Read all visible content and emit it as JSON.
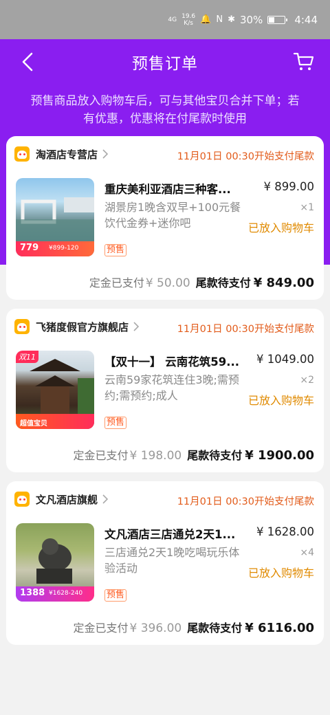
{
  "status_bar": {
    "signal": "4G",
    "speed_value": "19.6",
    "speed_unit": "K/s",
    "battery": "30%",
    "time": "4:44"
  },
  "header": {
    "title": "预售订单"
  },
  "notice": "预售商品放入购物车后，可与其他宝贝合并下单；若有优惠，优惠将在付尾款时使用",
  "orders": [
    {
      "shop_name": "淘酒店专营店",
      "deadline": "11月01日 00:30开始支付尾款",
      "title": "重庆美利亚酒店三种客...",
      "price": "¥ 899.00",
      "desc": "湖景房1晚含双早+100元餐饮代金券+迷你吧",
      "qty": "×1",
      "cart_status": "已放入购物车",
      "presale": "预售",
      "deposit_label": "定金已支付",
      "deposit_amount": "¥ 50.00",
      "balance_label": "尾款待支付",
      "balance_amount": "¥ 849.00",
      "thumb_big": "779",
      "thumb_tag": "¥899-120"
    },
    {
      "shop_name": "飞猪度假官方旗舰店",
      "deadline": "11月01日 00:30开始支付尾款",
      "title": "【双十一】 云南花筑59...",
      "price": "¥ 1049.00",
      "desc": "云南59家花筑连住3晚;需预约;需预约;成人",
      "qty": "×2",
      "cart_status": "已放入购物车",
      "presale": "预售",
      "deposit_label": "定金已支付",
      "deposit_amount": "¥ 198.00",
      "balance_label": "尾款待支付",
      "balance_amount": "¥ 1900.00",
      "thumb_badge": "双11",
      "thumb_big": "超值宝贝"
    },
    {
      "shop_name": "文凡酒店旗舰",
      "deadline": "11月01日 00:30开始支付尾款",
      "title": "文凡酒店三店通兑2天1...",
      "price": "¥ 1628.00",
      "desc": "三店通兑2天1晚吃喝玩乐体验活动",
      "qty": "×4",
      "cart_status": "已放入购物车",
      "presale": "预售",
      "deposit_label": "定金已支付",
      "deposit_amount": "¥ 396.00",
      "balance_label": "尾款待支付",
      "balance_amount": "¥ 6116.00",
      "thumb_big": "1388",
      "thumb_tag": "¥1628-240"
    }
  ],
  "icons": {
    "back": "back-arrow-icon",
    "cart": "shopping-cart-icon",
    "shop_logo": "fliggy-logo-icon",
    "chevron": "chevron-right-icon"
  },
  "colors": {
    "header_purple": "#8a1ef0",
    "deadline_orange": "#e25b1a",
    "cart_status_orange": "#e08a00"
  }
}
